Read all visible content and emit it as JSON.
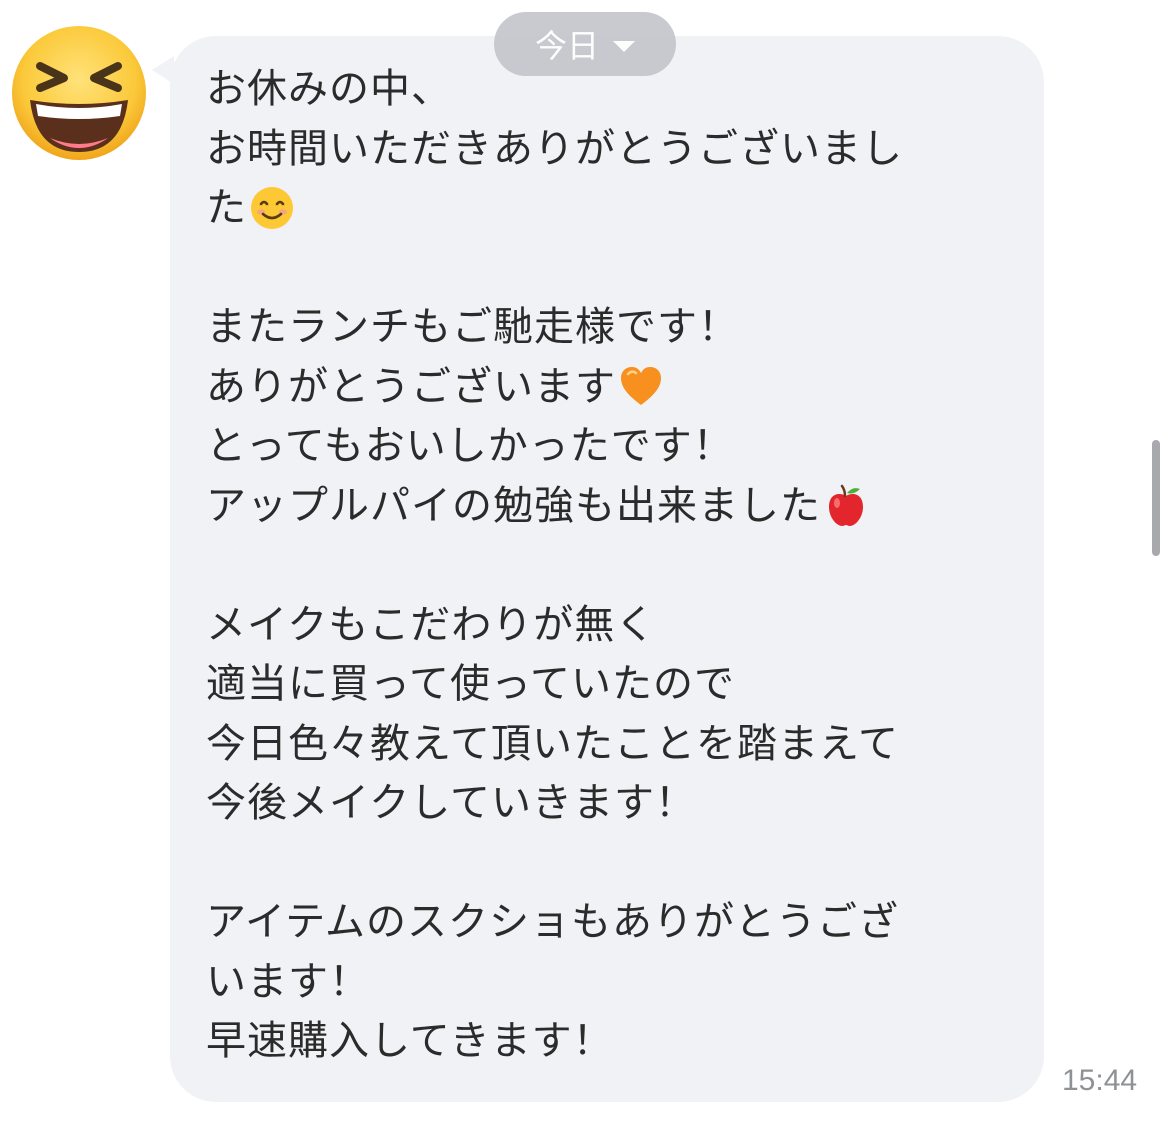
{
  "chat": {
    "date_pill": "今日",
    "timestamp": "15:44",
    "avatar_icon": "grinning-squinting-face-icon",
    "message_lines": [
      {
        "text": "お休みの中、"
      },
      {
        "text": "お時間いただきありがとうございまし"
      },
      {
        "text": "た",
        "emoji": "smiling-face-icon"
      },
      {
        "text": ""
      },
      {
        "text": "またランチもご馳走様です！"
      },
      {
        "text": "ありがとうございます",
        "emoji": "orange-heart-icon"
      },
      {
        "text": "とってもおいしかったです！"
      },
      {
        "text": "アップルパイの勉強も出来ました",
        "emoji": "red-apple-icon"
      },
      {
        "text": ""
      },
      {
        "text": "メイクもこだわりが無く"
      },
      {
        "text": "適当に買って使っていたので"
      },
      {
        "text": "今日色々教えて頂いたことを踏まえて"
      },
      {
        "text": "今後メイクしていきます！"
      },
      {
        "text": ""
      },
      {
        "text": "アイテムのスクショもありがとうござ"
      },
      {
        "text": "います！"
      },
      {
        "text": "早速購入してきます！"
      }
    ]
  },
  "colors": {
    "bubble_bg": "#f1f2f5",
    "text": "#2b2b2b",
    "date_pill_bg": "#c4c6cb",
    "timestamp": "#8e9196"
  }
}
